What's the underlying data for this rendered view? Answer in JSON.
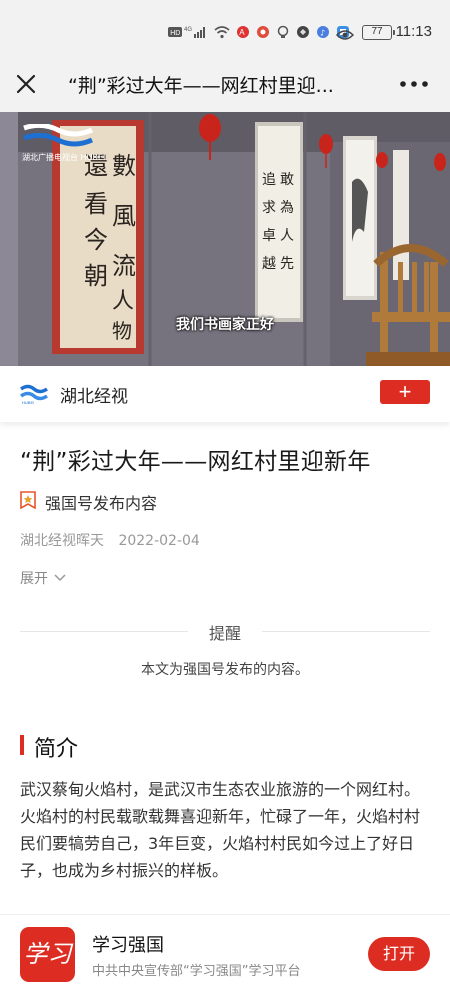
{
  "status_bar": {
    "time": "11:13",
    "battery": "77",
    "network_label": "HD"
  },
  "nav": {
    "title": "“荆”彩过大年——网红村里迎...",
    "close_icon": "close-icon",
    "more_icon": "more-horizontal-icon"
  },
  "video": {
    "caption": "我们书画家正好",
    "channel_logo_text": "湖北广播电视台 HUBEI"
  },
  "channel": {
    "name": "湖北经视",
    "follow_label": "+"
  },
  "article": {
    "title": "“荆”彩过大年——网红村里迎新年",
    "source_label": "强国号发布内容",
    "author": "湖北经视晖天",
    "date": "2022-02-04",
    "expand_label": "展开"
  },
  "notice": {
    "title": "提醒",
    "body": "本文为强国号发布的内容。"
  },
  "section": {
    "title": "简介",
    "summary": "武汉蔡甸火焰村，是武汉市生态农业旅游的一个网红村。火焰村的村民载歌载舞喜迎新年，忙碌了一年，火焰村村民们要犒劳自己，3年巨变，火焰村村民如今过上了好日子，也成为乡村振兴的样板。"
  },
  "banner": {
    "app_icon_text": "学习",
    "app_name": "学习强国",
    "app_desc": "中共中央宣传部“学习强国”学习平台",
    "open_label": "打开"
  },
  "colors": {
    "accent": "#dd2c22",
    "header_bg": "#f2f2f2"
  }
}
